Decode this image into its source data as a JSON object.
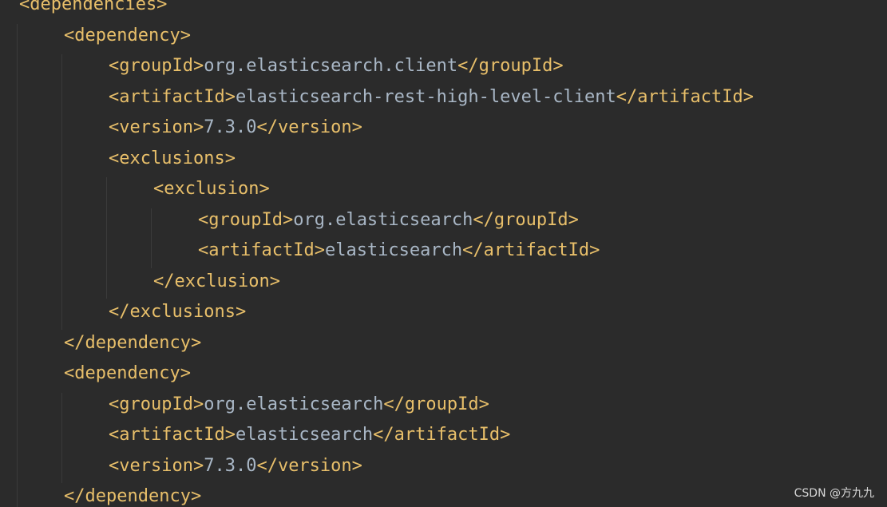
{
  "lines": [
    {
      "indent": 0,
      "open": "<dependencies>"
    },
    {
      "indent": 1,
      "open": "<dependency>"
    },
    {
      "indent": 2,
      "open": "<groupId>",
      "value": "org.elasticsearch.client",
      "close": "</groupId>"
    },
    {
      "indent": 2,
      "open": "<artifactId>",
      "value": "elasticsearch-rest-high-level-client",
      "close": "</artifactId>"
    },
    {
      "indent": 2,
      "open": "<version>",
      "value": "7.3.0",
      "close": "</version>"
    },
    {
      "indent": 2,
      "open": "<exclusions>"
    },
    {
      "indent": 3,
      "open": "<exclusion>"
    },
    {
      "indent": 4,
      "open": "<groupId>",
      "value": "org.elasticsearch",
      "close": "</groupId>"
    },
    {
      "indent": 4,
      "open": "<artifactId>",
      "value": "elasticsearch",
      "close": "</artifactId>"
    },
    {
      "indent": 3,
      "open": "</exclusion>"
    },
    {
      "indent": 2,
      "open": "</exclusions>"
    },
    {
      "indent": 1,
      "open": "</dependency>"
    },
    {
      "indent": 1,
      "open": "<dependency>"
    },
    {
      "indent": 2,
      "open": "<groupId>",
      "value": "org.elasticsearch",
      "close": "</groupId>"
    },
    {
      "indent": 2,
      "open": "<artifactId>",
      "value": "elasticsearch",
      "close": "</artifactId>"
    },
    {
      "indent": 2,
      "open": "<version>",
      "value": "7.3.0",
      "close": "</version>"
    },
    {
      "indent": 1,
      "open": "</dependency>"
    }
  ],
  "watermark": "CSDN @方九九",
  "colors": {
    "background": "#2b2b2b",
    "tag": "#e8bf6a",
    "text": "#a9b7c6",
    "indent_guide": "#3b3b3b"
  }
}
